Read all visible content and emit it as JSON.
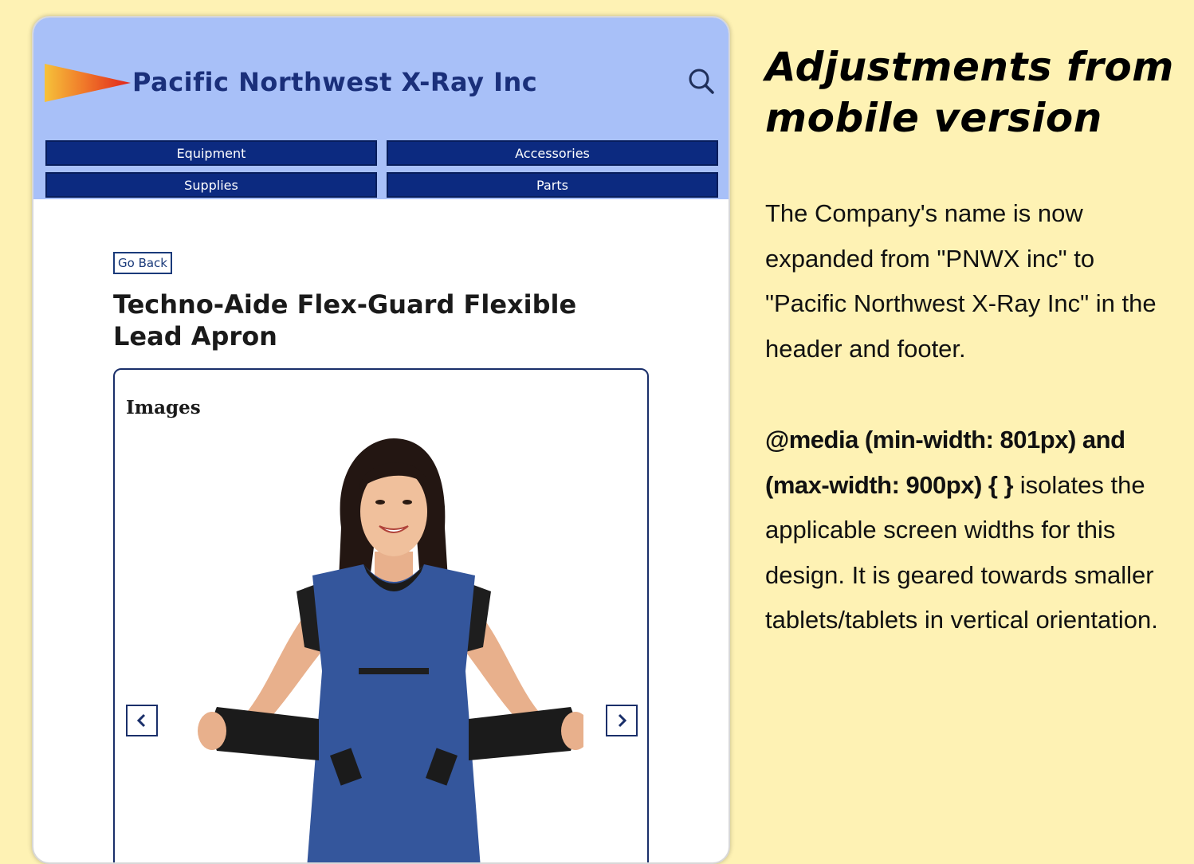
{
  "header": {
    "company_name": "Pacific Northwest X-Ray Inc",
    "nav": [
      {
        "label": "Equipment"
      },
      {
        "label": "Accessories"
      },
      {
        "label": "Supplies"
      },
      {
        "label": "Parts"
      }
    ],
    "search_icon": "search-icon"
  },
  "product": {
    "go_back_label": "Go Back",
    "title": "Techno-Aide Flex-Guard Flexible Lead Apron",
    "images_label": "Images",
    "prev_icon": "chevron-left-icon",
    "next_icon": "chevron-right-icon"
  },
  "notes": {
    "title": "Adjustments from mobile version",
    "paragraph1": "The Company's name is now expanded from \"PNWX inc\" to \"Pacific Northwest X-Ray Inc\" in the header and footer.",
    "media_query": "@media (min-width: 801px) and (max-width: 900px) { }",
    "paragraph2_rest": " isolates the applicable screen widths for this design. It is geared towards smaller tablets/tablets in vertical orientation."
  },
  "colors": {
    "page_background": "#fef2b4",
    "header_background": "#a8c0f8",
    "nav_button": "#0c2a80",
    "brand_text": "#1a2f7a"
  }
}
